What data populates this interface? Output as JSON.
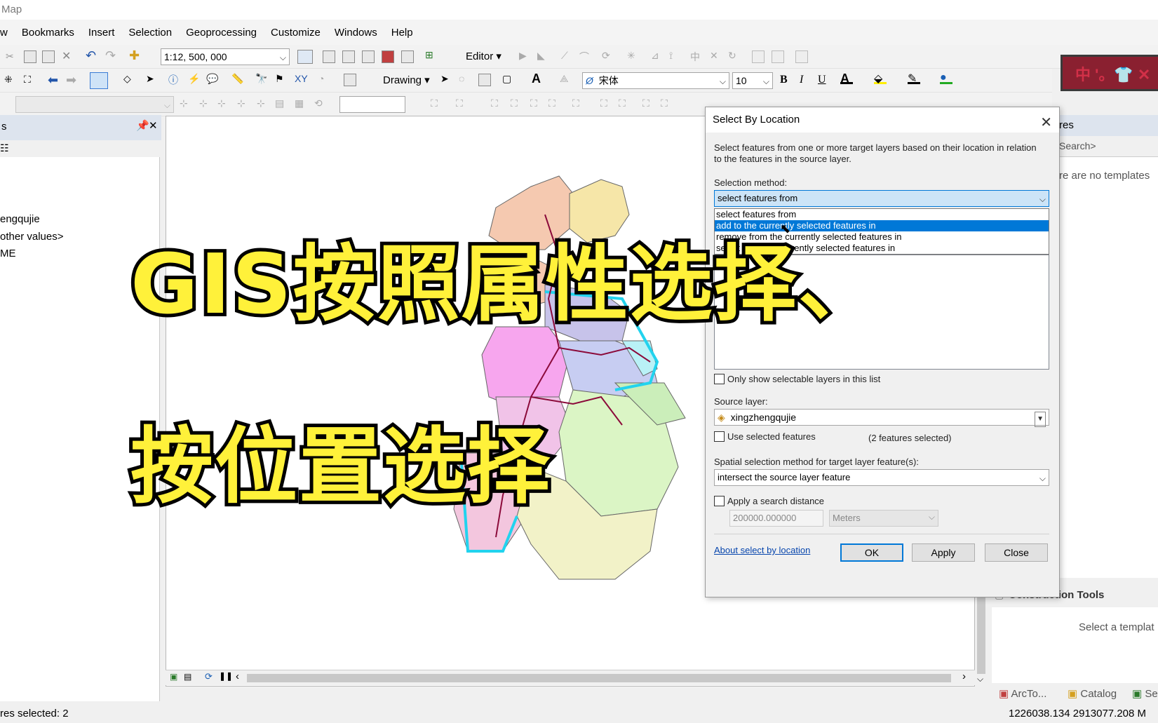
{
  "window": {
    "title": "Map"
  },
  "menu": [
    "w",
    "Bookmarks",
    "Insert",
    "Selection",
    "Geoprocessing",
    "Customize",
    "Windows",
    "Help"
  ],
  "toolbar": {
    "scale_value": "1:12, 500, 000",
    "editor_label": "Editor ▾",
    "drawing_label": "Drawing ▾",
    "font_name": "宋体",
    "font_size": "10",
    "bold": "B",
    "italic": "I",
    "underline": "U",
    "ime_text": "中 '。👕 ✕"
  },
  "toc": {
    "header": "s",
    "pin": "ᵖ",
    "close": "✕",
    "items": [
      "engqujie",
      "other values>",
      "ME"
    ]
  },
  "right_panel": {
    "header": "res",
    "search_placeholder": "Search>",
    "no_templates": "re are no templates",
    "construction_tools": "Construction Tools",
    "select_template": "Select a templat",
    "tabs": [
      "ArcTo...",
      "Catalog",
      "Se"
    ]
  },
  "status": {
    "selected": "res selected: 2",
    "coords": "1226038.134  2913077.208 M"
  },
  "dialog": {
    "title": "Select By Location",
    "description": "Select features from one or more target layers based on their location in relation to the features in the source layer.",
    "selection_method_label": "Selection method:",
    "selection_method_value": "select features from",
    "options": [
      "select features from",
      "add to the currently selected features in",
      "remove from the currently selected features in",
      "select from the currently selected features in"
    ],
    "only_selectable_label": "Only show selectable layers in this list",
    "source_layer_label": "Source layer:",
    "source_layer_value": "xingzhengqujie",
    "use_selected_label": "Use selected features",
    "features_selected": "(2 features selected)",
    "spatial_method_label": "Spatial selection method for target layer feature(s):",
    "spatial_method_value": "intersect the source layer feature",
    "apply_distance_label": "Apply a search distance",
    "distance_value": "200000.000000",
    "distance_unit": "Meters",
    "about_link": "About select by location",
    "ok": "OK",
    "apply": "Apply",
    "close": "Close"
  },
  "overlay": {
    "line1": "GIS按照属性选择、",
    "line2": "按位置选择"
  }
}
